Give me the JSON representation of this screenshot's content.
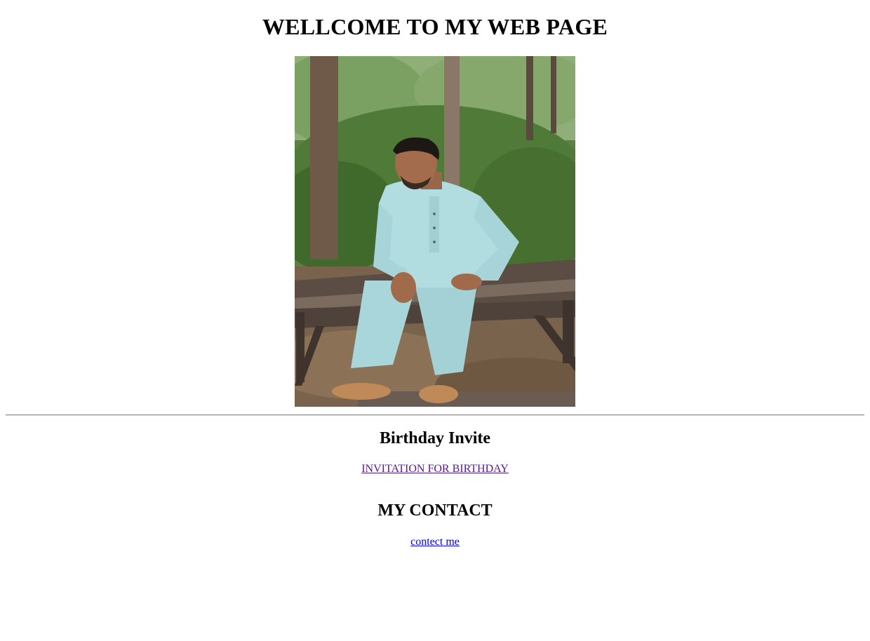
{
  "page": {
    "title": "WELLCOME TO MY WEB PAGE"
  },
  "sections": {
    "birthday": {
      "heading": "Birthday Invite",
      "link_text": "INVITATION FOR BIRTHDAY"
    },
    "contact": {
      "heading": "MY CONTACT",
      "link_text": "contect me"
    }
  },
  "colors": {
    "visited_link": "#551a8b",
    "unvisited_link": "#0000ee",
    "divider": "#8a8a8a"
  },
  "icons": {
    "photo": "portrait-photo"
  }
}
